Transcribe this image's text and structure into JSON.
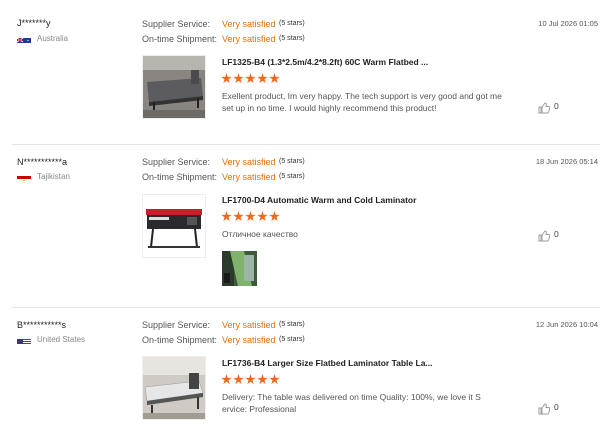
{
  "labels": {
    "supplier_service": "Supplier Service:",
    "on_time_shipment": "On-time Shipment:"
  },
  "colors": {
    "accent_orange": "#e0700f",
    "star": "#f06a1c"
  },
  "reviews": [
    {
      "user": "J*******y",
      "country": "Australia",
      "flag_icon": "australia-flag-icon",
      "supplier_service": "Very satisfied",
      "supplier_service_stars": "(5 stars)",
      "on_time_shipment": "Very satisfied",
      "on_time_shipment_stars": "(5 stars)",
      "date": "10 Jul 2026 01:05",
      "product_title": "LF1325-B4 (1.3*2.5m/4.2*8.2ft) 60C Warm Flatbed ...",
      "rating": 5,
      "text": "Exellent product, Im very happy. The tech support is very good and got me set up in no time. I would highly recommend this product!",
      "likes": "0"
    },
    {
      "user": "N***********a",
      "country": "Tajikistan",
      "flag_icon": "tajikistan-flag-icon",
      "supplier_service": "Very satisfied",
      "supplier_service_stars": "(5 stars)",
      "on_time_shipment": "Very satisfied",
      "on_time_shipment_stars": "(5 stars)",
      "date": "18 Jun 2026 05:14",
      "product_title": "LF1700-D4 Automatic Warm and Cold Laminator",
      "rating": 5,
      "text": "Отличное качество",
      "likes": "0"
    },
    {
      "user": "B***********s",
      "country": "United States",
      "flag_icon": "usa-flag-icon",
      "supplier_service": "Very satisfied",
      "supplier_service_stars": "(5 stars)",
      "on_time_shipment": "Very satisfied",
      "on_time_shipment_stars": "(5 stars)",
      "date": "12 Jun 2026 10:04",
      "product_title": "LF1736-B4 Larger Size Flatbed Laminator Table La...",
      "rating": 5,
      "text": "Delivery:    The table was delivered on time  Quality:   100%, we love it  S ervice:  Professional",
      "likes": "0"
    }
  ]
}
